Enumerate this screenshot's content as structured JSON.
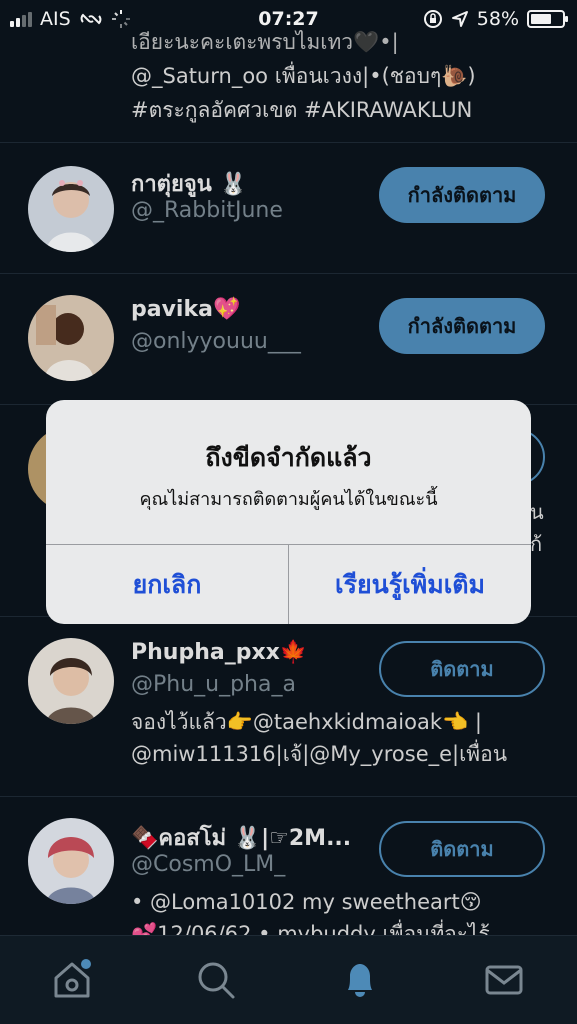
{
  "status": {
    "carrier": "AIS",
    "time": "07:27",
    "battery": "58%"
  },
  "top_bio": {
    "line1": "เอียะนะคะเตะพรบไมเทว🖤•|",
    "line2": "@_Saturn_oo เพื่อนเวงง|•(ชอบๆ🐌)",
    "line3": "#ตระกูลอัคศวเขต #AKIRAWAKLUN"
  },
  "users": [
    {
      "name": "กาตุ่ยจูน 🐰",
      "handle": "@_RabbitJune",
      "button": "กำลังติดตาม",
      "following": true,
      "bio": []
    },
    {
      "name": "pavika💖",
      "handle": "@onlyyouuu___",
      "button": "กำลังติดตาม",
      "following": true,
      "bio": []
    },
    {
      "name": "Phupha_pxx🍁",
      "handle": "@Phu_u_pha_a",
      "button": "ติดตาม",
      "following": false,
      "bio": [
        "จองไว้แล้ว👉@taehxkidmaioak👈 |",
        "@miw111316|เจ้|@My_yrose_e|เพื่อน"
      ]
    },
    {
      "name": "🍫คอสโม่ 🐰|☞2M...",
      "handle": "@CosmO_LM_",
      "button": "ติดตาม",
      "following": false,
      "bio": [
        "• @Loma10102 my sweetheart😚",
        "💕12/06/62 • mybuddy เพื่อนที่จะไร้"
      ]
    }
  ],
  "hidden_row": {
    "bio_fragment_1": "น",
    "bio_fragment_2": "ก้"
  },
  "alert": {
    "title": "ถึงขีดจำกัดแล้ว",
    "message": "คุณไม่สามารถติดตามผู้คนได้ในขณะนี้",
    "cancel": "ยกเลิก",
    "learn_more": "เรียนรู้เพิ่มเติม"
  },
  "tabs": [
    "home-icon",
    "search-icon",
    "notifications-icon",
    "messages-icon"
  ],
  "colors": {
    "accent": "#4d8ab7",
    "background": "#0b141c",
    "alert_button": "#1f4fd6"
  }
}
